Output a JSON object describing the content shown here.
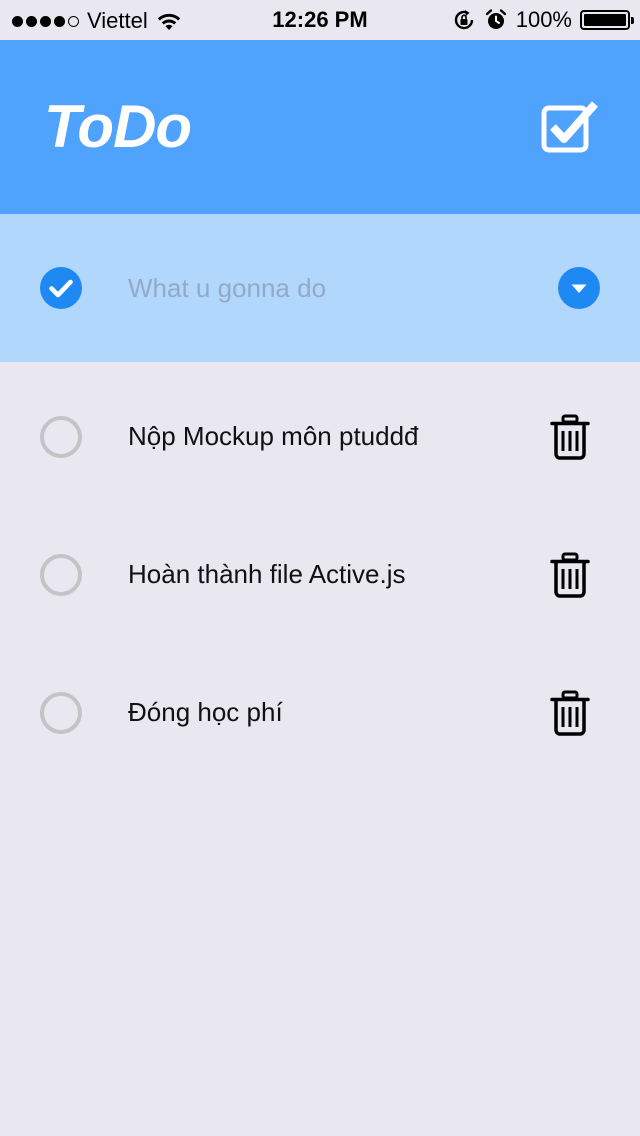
{
  "status_bar": {
    "carrier": "Viettel",
    "time": "12:26 PM",
    "battery": "100%",
    "battery_level": 1.0
  },
  "header": {
    "title": "ToDo",
    "check_all_icon": "checkbox-checked-icon",
    "bg_color": "#4fa3fc"
  },
  "new_todo": {
    "placeholder": "What u gonna do",
    "value": "",
    "bg_color": "#b2d7fd"
  },
  "todos": [
    {
      "text": "Nộp Mockup môn ptuddđ",
      "done": false
    },
    {
      "text": "Hoàn thành file Active.js",
      "done": false
    },
    {
      "text": "Đóng học phí",
      "done": false
    }
  ],
  "colors": {
    "accent": "#1e88f3",
    "background": "#e9e7f0",
    "unchecked": "#c4c4c6"
  }
}
